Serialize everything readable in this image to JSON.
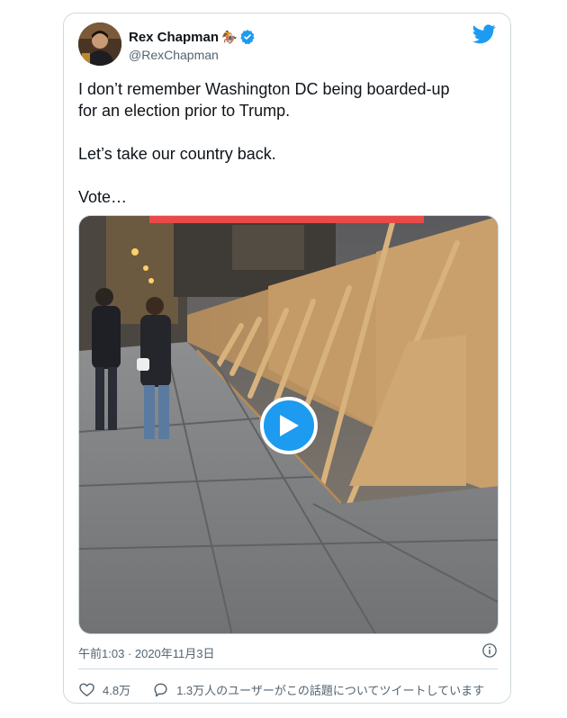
{
  "author": {
    "name": "Rex Chapman",
    "emoji": "🏇",
    "handle": "@RexChapman"
  },
  "tweet": {
    "text": "I don’t remember Washington DC being boarded-up\nfor an election prior to Trump.\n\nLet’s take our country back.\n\nVote…"
  },
  "meta": {
    "timestamp": "午前1:03 · 2020年11月3日"
  },
  "actions": {
    "likes": "4.8万",
    "replies_text": "1.3万人のユーザーがこの話題についてツイートしています"
  },
  "colors": {
    "accent": "#1d9bf0",
    "text": "#0f1419",
    "muted": "#536471",
    "border": "#cfd9de"
  },
  "icons": [
    "twitter-bird-icon",
    "verified-badge-icon",
    "play-icon",
    "info-icon",
    "heart-icon",
    "reply-icon"
  ]
}
